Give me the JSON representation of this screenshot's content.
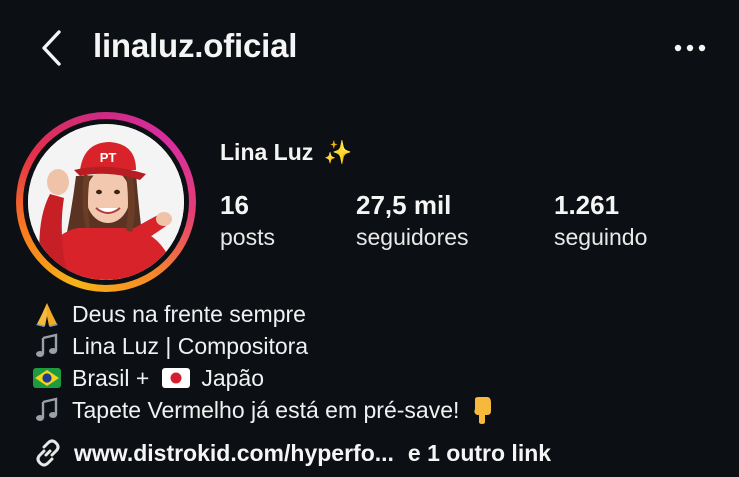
{
  "header": {
    "username": "linaluz.oficial",
    "back_icon": "chevron-left-icon",
    "more_icon": "more-horizontal-icon"
  },
  "profile": {
    "display_name": "Lina Luz",
    "name_emoji": "✨",
    "avatar_cap_text": "PT",
    "stats": [
      {
        "value": "16",
        "label": "posts"
      },
      {
        "value": "27,5 mil",
        "label": "seguidores"
      },
      {
        "value": "1.261",
        "label": "seguindo"
      }
    ]
  },
  "bio": {
    "line1": "Deus na frente sempre",
    "line2": "Lina Luz | Compositora",
    "line3_a": "Brasil +",
    "line3_b": "Japão",
    "line4": "Tapete Vermelho já está em pré-save!"
  },
  "links": {
    "primary": "www.distrokid.com/hyperfo...",
    "extra": "e 1 outro link"
  },
  "colors": {
    "background": "#0c0f14",
    "text": "#f5f5f5",
    "story_ring_start": "#f5b418",
    "story_ring_end": "#d72ea0",
    "cap_red": "#d8232a"
  }
}
